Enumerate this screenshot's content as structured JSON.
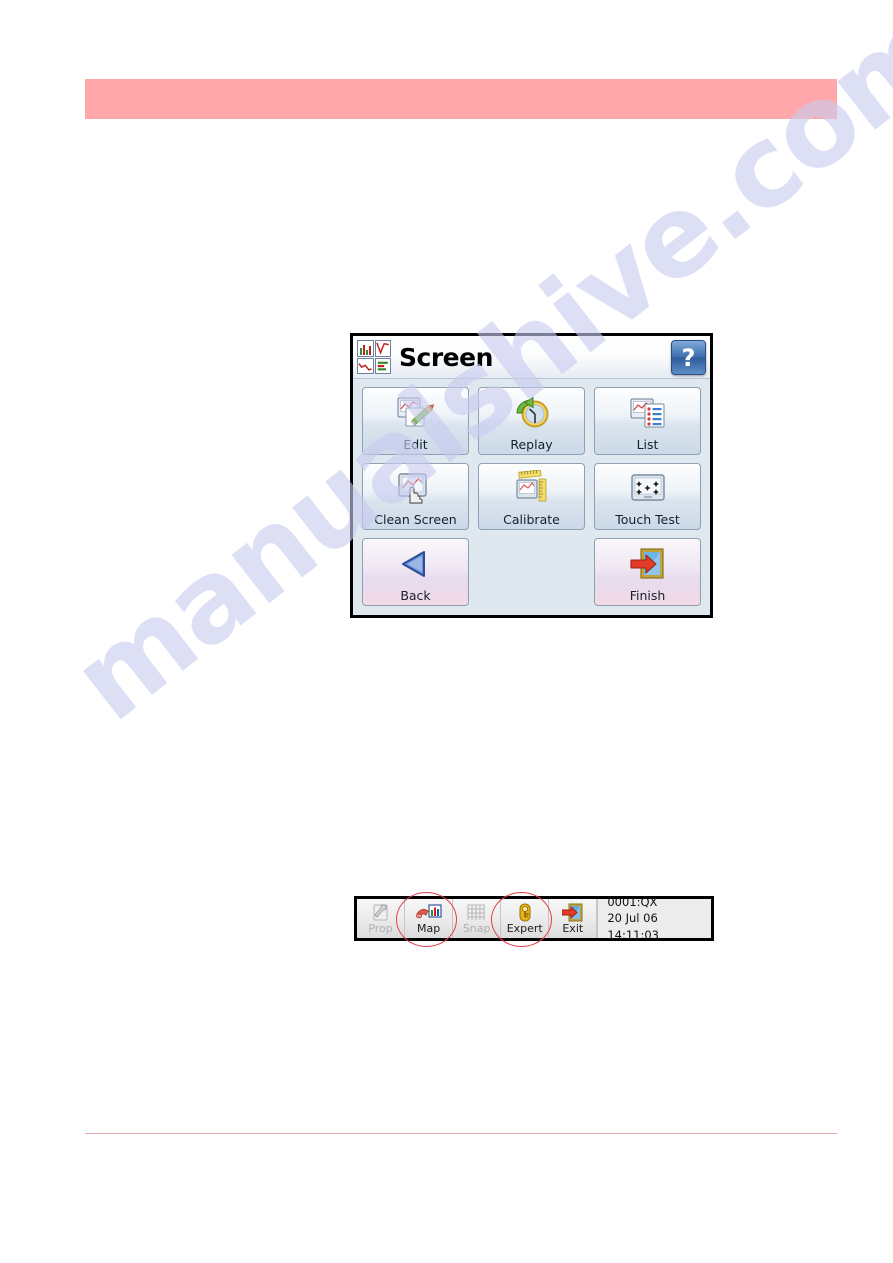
{
  "page": {
    "header_band_text": "",
    "watermark_text": "manualshive.com",
    "watermark_color": "#c9ccf0",
    "header_band_color": "#ffa8ab",
    "footer_rule_color": "#e3aaaa"
  },
  "device_dialog": {
    "title": "Screen",
    "title_icon": "four-chart-quadrant-icon",
    "help_label": "?",
    "tiles": [
      {
        "label": "Edit",
        "icon": "edit-chart-pencil-icon",
        "style": "blue"
      },
      {
        "label": "Replay",
        "icon": "replay-clock-arrow-icon",
        "style": "blue"
      },
      {
        "label": "List",
        "icon": "list-chart-icon",
        "style": "blue"
      },
      {
        "label": "Clean Screen",
        "icon": "clean-screen-hand-icon",
        "style": "blue"
      },
      {
        "label": "Calibrate",
        "icon": "calibrate-ruler-icon",
        "style": "blue"
      },
      {
        "label": "Touch Test",
        "icon": "touch-test-dots-icon",
        "style": "blue"
      },
      {
        "label": "Back",
        "icon": "back-triangle-icon",
        "style": "pink"
      },
      {
        "label": "",
        "icon": "",
        "style": "empty"
      },
      {
        "label": "Finish",
        "icon": "finish-exit-door-icon",
        "style": "pink"
      }
    ]
  },
  "toolbar": {
    "buttons": [
      {
        "label": "Prop",
        "icon": "properties-wrench-icon",
        "enabled": false,
        "annotated": false
      },
      {
        "label": "Map",
        "icon": "map-chart-icon",
        "enabled": true,
        "annotated": true
      },
      {
        "label": "Snap",
        "icon": "snap-grid-icon",
        "enabled": false,
        "annotated": false
      },
      {
        "label": "Expert",
        "icon": "expert-key-icon",
        "enabled": true,
        "annotated": true
      },
      {
        "label": "Exit",
        "icon": "exit-door-arrow-icon",
        "enabled": true,
        "annotated": false
      }
    ],
    "info": {
      "id_line": "0001:QX",
      "datetime_line": "20 Jul 06  14:11:03"
    }
  },
  "annotations": {
    "ellipse_color": "#e2404a",
    "circled_items": [
      "Map",
      "Expert"
    ]
  }
}
